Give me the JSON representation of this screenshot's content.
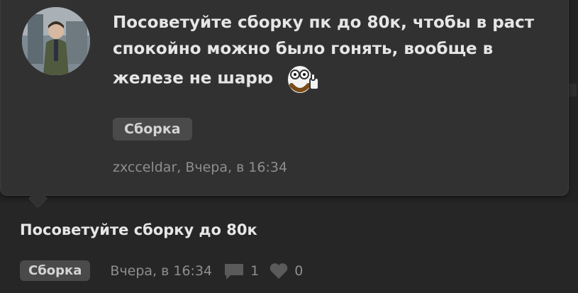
{
  "popup": {
    "avatar_name": "user-avatar",
    "message": "Посоветуйте сборку пк до 80к, чтобы в раст спокойно можно было гонять, вообще в железе не шарю",
    "tag": "Сборка",
    "author_time": "zxcceldar, Вчера, в 16:34"
  },
  "post": {
    "title": "Посоветуйте сборку до 80к",
    "tag": "Сборка",
    "time": "Вчера, в 16:34",
    "comments_count": "1",
    "likes_count": "0",
    "icons": [
      "comment-icon",
      "heart-icon"
    ]
  },
  "colors": {
    "background": "#262626",
    "popup_bg": "#313131",
    "tag_bg": "#4a4a4a",
    "text": "#e6e6e6",
    "muted": "#8e8e8e"
  }
}
